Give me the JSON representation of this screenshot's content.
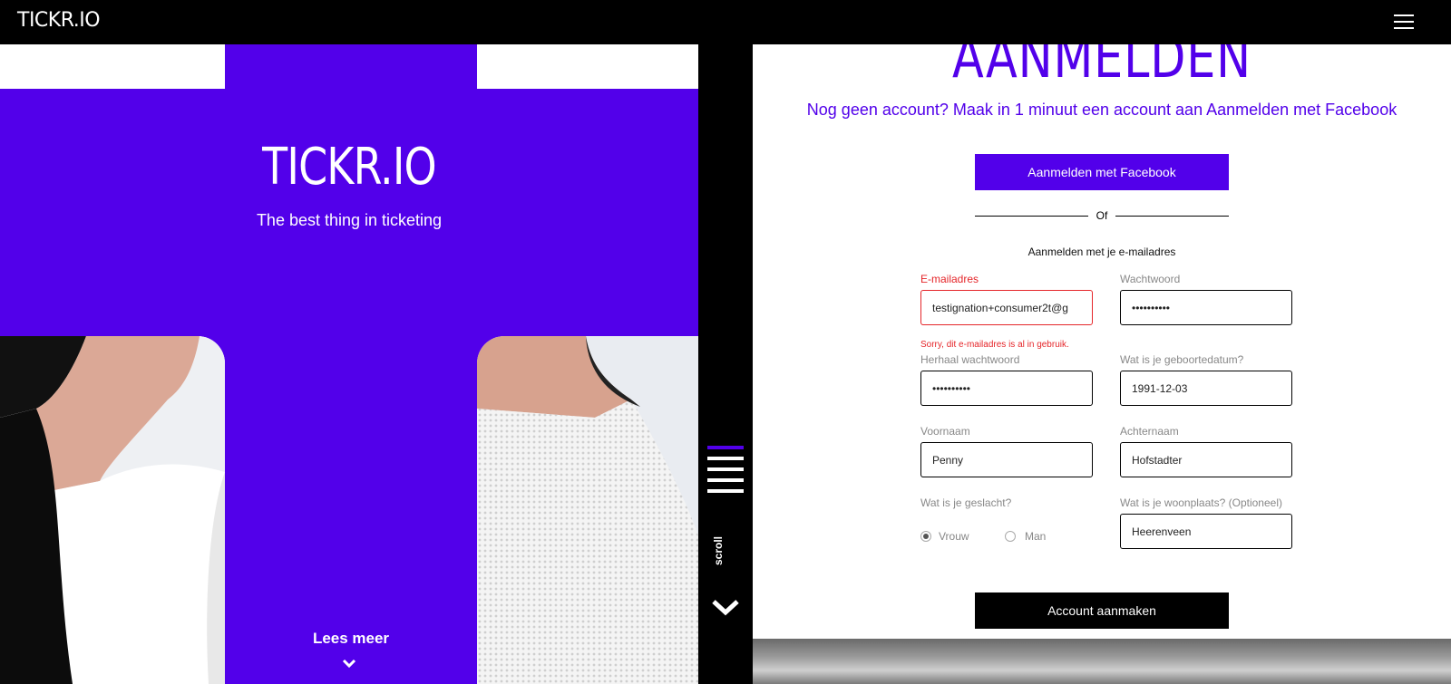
{
  "topbar": {
    "logo": "TICKR.IO",
    "menu_icon": "hamburger-icon"
  },
  "hero": {
    "title": "TICKR.IO",
    "subtitle": "The best thing in ticketing",
    "read_more": "Lees meer",
    "read_more_icon": "chevron-down-icon"
  },
  "side": {
    "scroll_label": "scroll",
    "scroll_icon": "chevron-down-icon"
  },
  "signup": {
    "title": "AANMELDEN",
    "subtitle": "Nog geen account? Maak in 1 minuut een account aan Aanmelden met Facebook",
    "facebook_button": "Aanmelden met Facebook",
    "or": "Of",
    "email_heading": "Aanmelden met je e-mailadres",
    "fields": {
      "email": {
        "label": "E-mailadres",
        "value": "testignation+consumer2t@g",
        "error": "Sorry, dit e-mailadres is al in gebruik."
      },
      "password": {
        "label": "Wachtwoord",
        "value": "••••••••••"
      },
      "repeat_password": {
        "label": "Herhaal wachtwoord",
        "value": "••••••••••"
      },
      "birthdate": {
        "label": "Wat is je geboortedatum?",
        "value": "1991-12-03"
      },
      "first_name": {
        "label": "Voornaam",
        "value": "Penny"
      },
      "last_name": {
        "label": "Achternaam",
        "value": "Hofstadter"
      },
      "gender": {
        "label": "Wat is je geslacht?",
        "options": [
          "Vrouw",
          "Man"
        ],
        "selected": "Vrouw"
      },
      "city": {
        "label": "Wat is je woonplaats? (Optioneel)",
        "value": "Heerenveen"
      }
    },
    "create_button": "Account aanmaken"
  },
  "colors": {
    "accent": "#5200ea",
    "error": "#e5262a",
    "black": "#000000"
  }
}
